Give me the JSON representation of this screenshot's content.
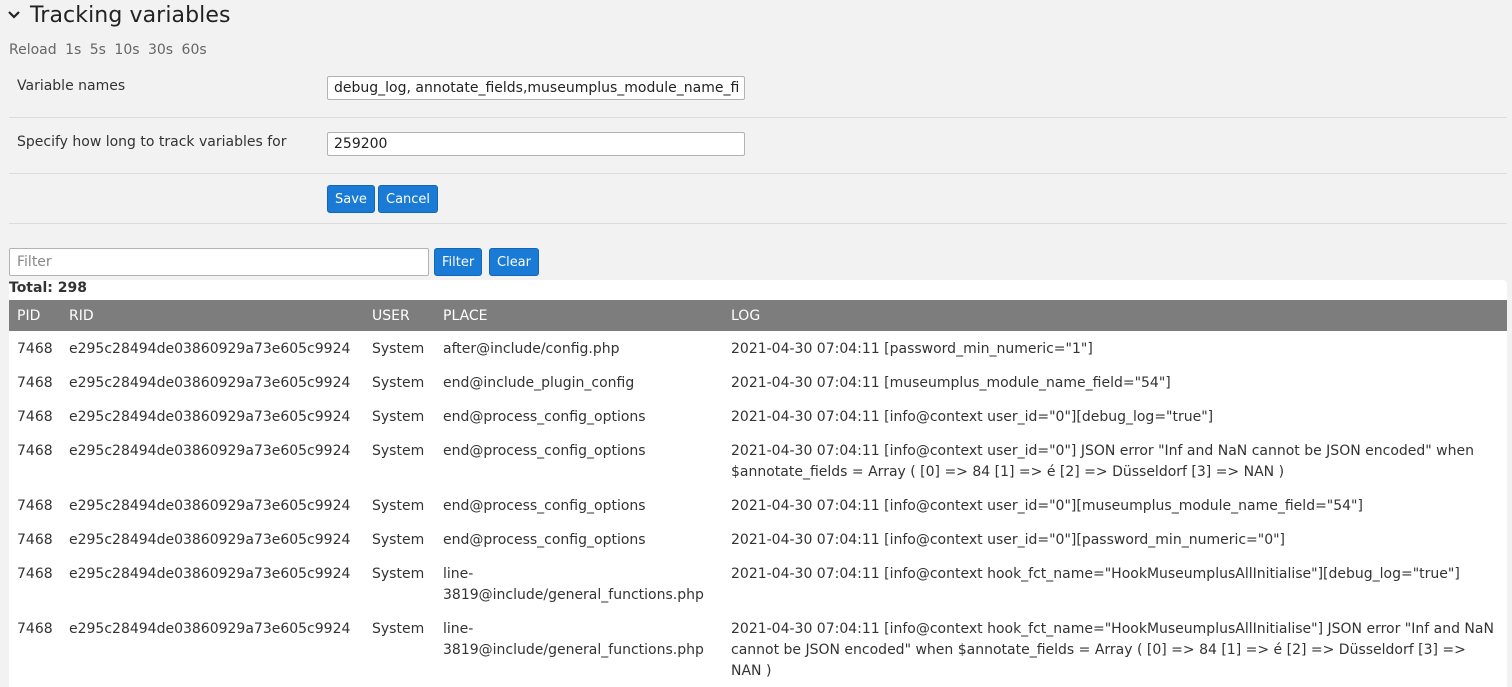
{
  "section": {
    "title": "Tracking variables"
  },
  "reload": {
    "label": "Reload",
    "options": [
      "1s",
      "5s",
      "10s",
      "30s",
      "60s"
    ]
  },
  "form": {
    "variable_names_label": "Variable names",
    "variable_names_value": "debug_log, annotate_fields,museumplus_module_name_field",
    "duration_label": "Specify how long to track variables for",
    "duration_value": "259200",
    "save_label": "Save",
    "cancel_label": "Cancel"
  },
  "filter": {
    "placeholder": "Filter",
    "filter_label": "Filter",
    "clear_label": "Clear"
  },
  "total": "Total: 298",
  "table": {
    "headers": [
      "PID",
      "RID",
      "USER",
      "PLACE",
      "LOG"
    ],
    "rows": [
      [
        "7468",
        "e295c28494de03860929a73e605c9924",
        "System",
        "after@include/config.php",
        "2021-04-30 07:04:11 [password_min_numeric=\"1\"]"
      ],
      [
        "7468",
        "e295c28494de03860929a73e605c9924",
        "System",
        "end@include_plugin_config",
        "2021-04-30 07:04:11 [museumplus_module_name_field=\"54\"]"
      ],
      [
        "7468",
        "e295c28494de03860929a73e605c9924",
        "System",
        "end@process_config_options",
        "2021-04-30 07:04:11 [info@context user_id=\"0\"][debug_log=\"true\"]"
      ],
      [
        "7468",
        "e295c28494de03860929a73e605c9924",
        "System",
        "end@process_config_options",
        "2021-04-30 07:04:11 [info@context user_id=\"0\"] JSON error \"Inf and NaN cannot be JSON encoded\" when $annotate_fields = Array ( [0] => 84 [1] => é [2] => Düsseldorf [3] => NAN )"
      ],
      [
        "7468",
        "e295c28494de03860929a73e605c9924",
        "System",
        "end@process_config_options",
        "2021-04-30 07:04:11 [info@context user_id=\"0\"][museumplus_module_name_field=\"54\"]"
      ],
      [
        "7468",
        "e295c28494de03860929a73e605c9924",
        "System",
        "end@process_config_options",
        "2021-04-30 07:04:11 [info@context user_id=\"0\"][password_min_numeric=\"0\"]"
      ],
      [
        "7468",
        "e295c28494de03860929a73e605c9924",
        "System",
        "line-3819@include/general_functions.php",
        "2021-04-30 07:04:11 [info@context hook_fct_name=\"HookMuseumplusAllInitialise\"][debug_log=\"true\"]"
      ],
      [
        "7468",
        "e295c28494de03860929a73e605c9924",
        "System",
        "line-3819@include/general_functions.php",
        "2021-04-30 07:04:11 [info@context hook_fct_name=\"HookMuseumplusAllInitialise\"] JSON error \"Inf and NaN cannot be JSON encoded\" when $annotate_fields = Array ( [0] => 84 [1] => é [2] => Düsseldorf [3] => NAN )"
      ]
    ]
  },
  "colors": {
    "accent": "#1a7bd6",
    "table_header": "#7d7d7d",
    "background": "#f2f2f2"
  },
  "icons": {
    "collapse": "chevron-down-icon"
  }
}
